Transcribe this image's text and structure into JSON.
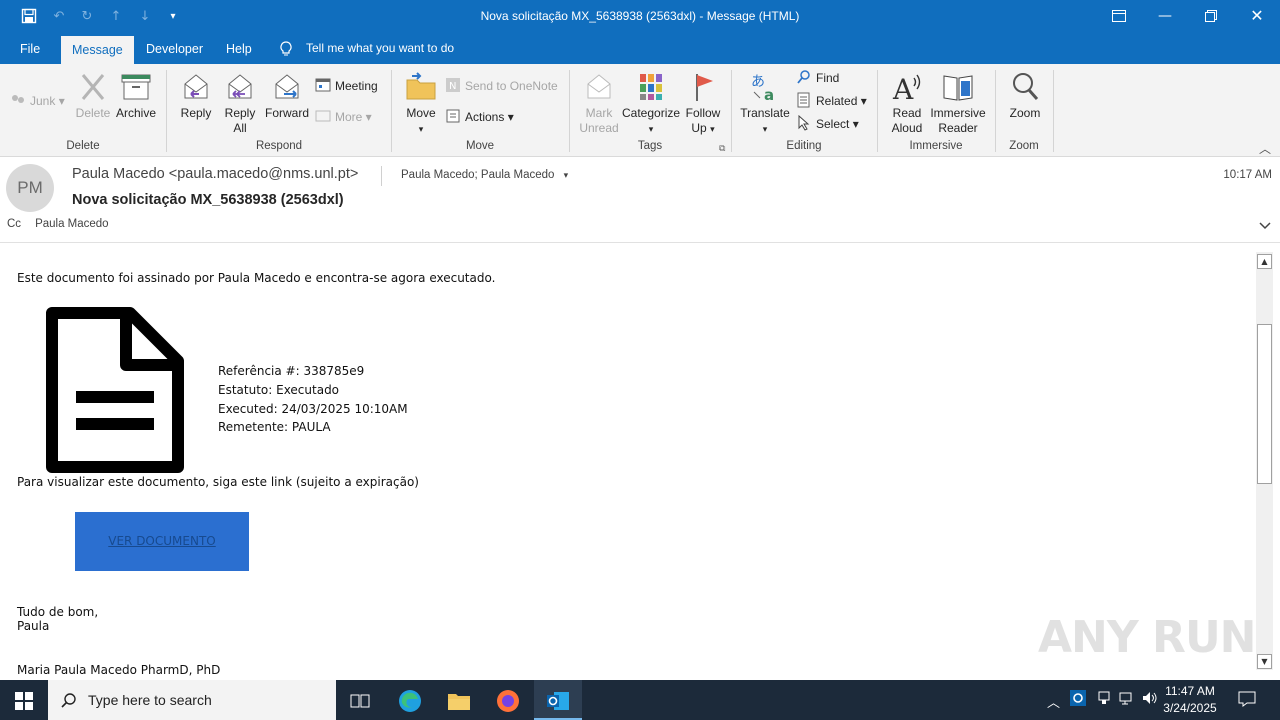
{
  "window": {
    "title": "Nova solicitação MX_5638938 (2563dxl)  -  Message (HTML)"
  },
  "menu": {
    "tabs": [
      "File",
      "Message",
      "Developer",
      "Help"
    ],
    "tell_me": "Tell me what you want to do"
  },
  "ribbon": {
    "delete_group": {
      "label": "Delete",
      "junk": "Junk",
      "delete": "Delete",
      "archive": "Archive"
    },
    "respond_group": {
      "label": "Respond",
      "reply": "Reply",
      "reply_all_1": "Reply",
      "reply_all_2": "All",
      "forward": "Forward",
      "meeting": "Meeting",
      "more": "More"
    },
    "move_group": {
      "label": "Move",
      "move": "Move",
      "send_onenote": "Send to OneNote",
      "actions": "Actions"
    },
    "tags_group": {
      "label": "Tags",
      "mark_1": "Mark",
      "mark_2": "Unread",
      "categorize": "Categorize",
      "follow_1": "Follow",
      "follow_2": "Up"
    },
    "editing_group": {
      "label": "Editing",
      "translate": "Translate",
      "find": "Find",
      "related": "Related",
      "select": "Select"
    },
    "immersive_group": {
      "label": "Immersive",
      "read_1": "Read",
      "read_2": "Aloud",
      "immersive_1": "Immersive",
      "immersive_2": "Reader"
    },
    "zoom_group": {
      "label": "Zoom",
      "zoom": "Zoom"
    }
  },
  "message": {
    "avatar_initials": "PM",
    "sender": "Paula Macedo <paula.macedo@nms.unl.pt>",
    "recipients": "Paula Macedo; Paula Macedo",
    "time": "10:17 AM",
    "subject": "Nova solicitação MX_5638938 (2563dxl)",
    "cc_label": "Cc",
    "cc_value": "Paula Macedo"
  },
  "body": {
    "intro": "Este documento foi assinado por Paula Macedo e encontra-se agora executado.",
    "ref": "Referência #:  338785e9",
    "status": "Estatuto: Executado",
    "executed": "Executed:  24/03/2025 10:10AM",
    "sender": "Remetente:  PAULA",
    "view_text": "Para visualizar este documento, siga este link (sujeito a expiração)",
    "button": "VER DOCUMENTO",
    "closing_1": "Tudo de bom,",
    "closing_2": "Paula",
    "signature": "Maria Paula Macedo PharmD, PhD"
  },
  "watermark": "ANY RUN",
  "taskbar": {
    "search_placeholder": "Type here to search",
    "time": "11:47 AM",
    "date": "3/24/2025"
  },
  "colors": {
    "titlebar": "#106ebe",
    "ribbon": "#f3f3f3",
    "button": "#2b6fd0",
    "taskbar": "#1c2a3a"
  }
}
